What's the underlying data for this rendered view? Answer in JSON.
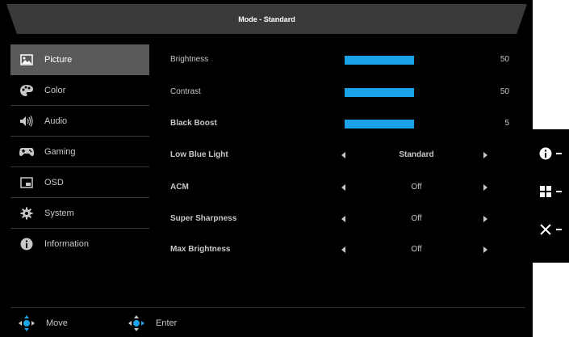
{
  "title": "Mode - Standard",
  "sidebar": {
    "items": [
      {
        "label": "Picture",
        "icon": "picture-icon",
        "active": true
      },
      {
        "label": "Color",
        "icon": "palette-icon"
      },
      {
        "label": "Audio",
        "icon": "speaker-icon"
      },
      {
        "label": "Gaming",
        "icon": "gamepad-icon"
      },
      {
        "label": "OSD",
        "icon": "osd-icon"
      },
      {
        "label": "System",
        "icon": "gear-icon"
      },
      {
        "label": "Information",
        "icon": "info-icon"
      }
    ]
  },
  "settings": {
    "brightness": {
      "label": "Brightness",
      "value": "50",
      "level": 0.5
    },
    "contrast": {
      "label": "Contrast",
      "value": "50",
      "level": 0.5
    },
    "black_boost": {
      "label": "Black Boost",
      "value": "5",
      "level": 0.5
    },
    "low_blue_light": {
      "label": "Low Blue Light",
      "value": "Standard"
    },
    "acm": {
      "label": "ACM",
      "value": "Off"
    },
    "super_sharpness": {
      "label": "Super Sharpness",
      "value": "Off"
    },
    "max_brightness": {
      "label": "Max Brightness",
      "value": "Off"
    }
  },
  "footer": {
    "move_label": "Move",
    "enter_label": "Enter"
  },
  "colors": {
    "accent": "#1aa3e8",
    "active_bg": "#5a5a5a",
    "background": "#000000"
  }
}
